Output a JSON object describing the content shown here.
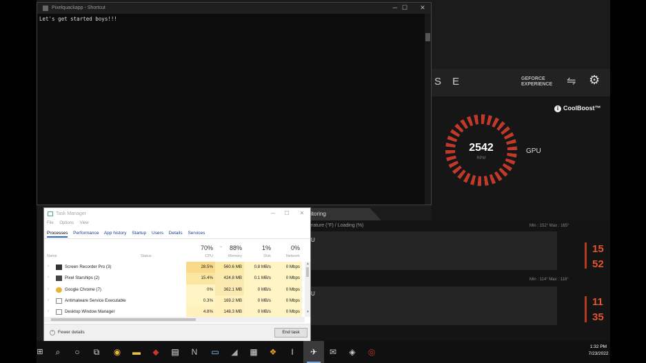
{
  "terminal": {
    "title": "Pixelquackapp - Shortcut",
    "output": "Let's get started boys!!!",
    "controls": {
      "minimize": "─",
      "maximize": "☐",
      "close": "✕"
    }
  },
  "msi": {
    "header_text": "S E",
    "geforce_line1": "GEFORCE",
    "geforce_line2": "EXPERIENCE",
    "coolboost": "CoolBoost™",
    "fan_value": "2542",
    "fan_unit": "RPM",
    "fan_label": "GPU",
    "monitoring_tab": "itoring",
    "monitor_title": "erature (°F) / Loading (%)",
    "row1": {
      "label": "U",
      "minmax": "Min : 152°   Max : 165°",
      "val_top": "15",
      "val_bottom": "52"
    },
    "row2": {
      "label": "U",
      "minmax": "Min : 114°   Max : 118°",
      "val_top": "11",
      "val_bottom": "35"
    },
    "accent_color": "#e2562d"
  },
  "taskmgr": {
    "title": "Task Manager",
    "menu": [
      "File",
      "Options",
      "View"
    ],
    "tabs": [
      "Processes",
      "Performance",
      "App history",
      "Startup",
      "Users",
      "Details",
      "Services"
    ],
    "active_tab": "Processes",
    "totals": {
      "cpu": "70%",
      "memory": "88%",
      "disk": "1%",
      "network": "0%"
    },
    "columns": {
      "name": "Name",
      "status": "Status",
      "cpu": "CPU",
      "memory": "Memory",
      "disk": "Disk",
      "network": "Network"
    },
    "rows": [
      {
        "name": "Screen Recorder Pro (3)",
        "cpu": "28.5%",
        "memory": "560.6 MB",
        "disk": "0.8 MB/s",
        "network": "0 Mbps"
      },
      {
        "name": "Pixel Starships (2)",
        "cpu": "15.4%",
        "memory": "424.8 MB",
        "disk": "0.1 MB/s",
        "network": "0 Mbps"
      },
      {
        "name": "Google Chrome (7)",
        "cpu": "0%",
        "memory": "362.1 MB",
        "disk": "0 MB/s",
        "network": "0 Mbps"
      },
      {
        "name": "Antimalware Service Executable",
        "cpu": "0.3%",
        "memory": "169.2 MB",
        "disk": "0 MB/s",
        "network": "0 Mbps"
      },
      {
        "name": "Desktop Window Manager",
        "cpu": "4.8%",
        "memory": "148.3 MB",
        "disk": "0 MB/s",
        "network": "0 Mbps"
      }
    ],
    "fewer_details": "Fewer details",
    "end_task": "End task"
  },
  "taskbar": {
    "icons": [
      "start-icon",
      "search-icon",
      "cortana-icon",
      "task-view-icon",
      "chrome-icon",
      "file-explorer-icon",
      "app-icon",
      "notepad-icon",
      "app-icon",
      "terminal-icon",
      "app-icon",
      "app-icon",
      "app-icon",
      "app-icon",
      "app-icon",
      "app-icon",
      "game-icon",
      "app-icon",
      "app-icon",
      "app-icon"
    ],
    "time": "1:32 PM",
    "date": "7/23/2022"
  }
}
